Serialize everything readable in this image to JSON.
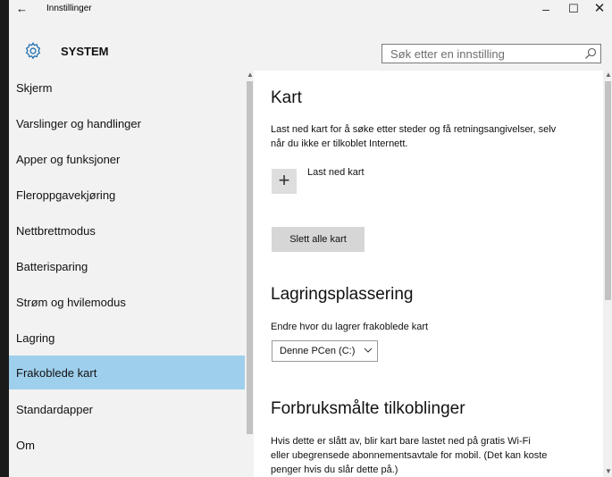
{
  "window": {
    "title": "Innstillinger",
    "back_glyph": "←",
    "caption": {
      "minimize": "–",
      "maximize": "☐",
      "close": "✕"
    }
  },
  "header": {
    "icon": "gear-icon",
    "title": "SYSTEM",
    "search_placeholder": "Søk etter en innstilling"
  },
  "sidebar": {
    "selected_color": "#9ecfec",
    "items": [
      {
        "label": "Skjerm",
        "selected": false
      },
      {
        "label": "Varslinger og handlinger",
        "selected": false
      },
      {
        "label": "Apper og funksjoner",
        "selected": false
      },
      {
        "label": "Fleroppgavekjøring",
        "selected": false
      },
      {
        "label": "Nettbrettmodus",
        "selected": false
      },
      {
        "label": "Batterisparing",
        "selected": false
      },
      {
        "label": "Strøm og hvilemodus",
        "selected": false
      },
      {
        "label": "Lagring",
        "selected": false
      },
      {
        "label": "Frakoblede kart",
        "selected": true
      },
      {
        "label": "Standardapper",
        "selected": false
      },
      {
        "label": "Om",
        "selected": false
      }
    ]
  },
  "content": {
    "maps": {
      "heading": "Kart",
      "description_line1": "Last ned kart for å søke etter steder og få retningsangivelser, selv",
      "description_line2": "når du ikke er tilkoblet Internett.",
      "download_icon_glyph": "+",
      "download_label": "Last ned kart",
      "delete_all_label": "Slett alle kart"
    },
    "storage": {
      "heading": "Lagringsplassering",
      "description": "Endre hvor du lagrer frakoblede kart",
      "selected_drive": "Denne PCen (C:)"
    },
    "metered": {
      "heading": "Forbruksmålte tilkoblinger",
      "line1": "Hvis dette er slått av, blir kart bare lastet ned på gratis Wi-Fi",
      "line2": "eller ubegrensede abonnementsavtale for mobil. (Det kan koste",
      "line3": "penger hvis du slår dette på.)"
    }
  }
}
